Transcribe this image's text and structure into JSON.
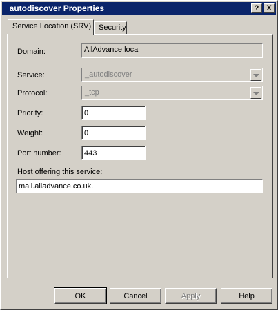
{
  "window": {
    "title": "_autodiscover Properties",
    "help_glyph": "?",
    "close_glyph": "X"
  },
  "tabs": [
    {
      "label": "Service Location (SRV)",
      "active": true
    },
    {
      "label": "Security",
      "active": false
    }
  ],
  "form": {
    "domain_label": "Domain:",
    "domain_value": "AllAdvance.local",
    "service_label": "Service:",
    "service_value": "_autodiscover",
    "protocol_label": "Protocol:",
    "protocol_value": "_tcp",
    "priority_label": "Priority:",
    "priority_value": "0",
    "weight_label": "Weight:",
    "weight_value": "0",
    "port_label": "Port number:",
    "port_value": "443",
    "host_label": "Host offering this service:",
    "host_value": "mail.alladvance.co.uk."
  },
  "buttons": {
    "ok": "OK",
    "cancel": "Cancel",
    "apply": "Apply",
    "help": "Help"
  },
  "icons": [
    "chevron-down-icon"
  ]
}
